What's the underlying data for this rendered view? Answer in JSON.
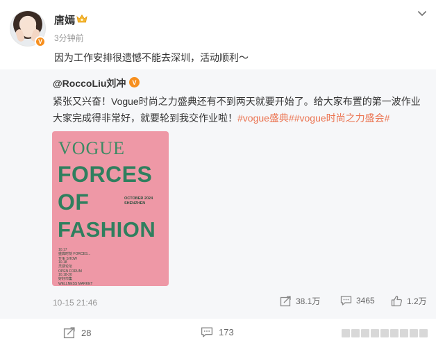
{
  "post": {
    "author": "唐嫣",
    "time": "3分钟前",
    "text": "因为工作安排很遗憾不能去深圳，活动顺利～"
  },
  "repost": {
    "author": "@RoccoLiu刘冲",
    "line1": "紧张又兴奋！Vogue时尚之力盛典还有不到两天就要开始了。给大家布置的第一波作业",
    "line2_plain": "大家完成得非常好，就要轮到我交作业啦！",
    "hashtags": "#vogue盛典##vogue时尚之力盛会#",
    "poster": {
      "brand": "VOGUE",
      "line1": "FORCES",
      "line2": "OF",
      "line3": "FASHION",
      "date_line1": "OCTOBER 2024",
      "date_line2": "SHENZHEN",
      "small1": "10.17\n盛典时刻 FORCES...\nTHE SHOW",
      "small2": "10.18\n灵感论坛\nOPEN FORUM",
      "small3": "10.18-20\n好好市集\nWELLNESS MARKET"
    },
    "time": "10-15 21:46",
    "shares": "38.1万",
    "comments": "3465",
    "likes": "1.2万"
  },
  "actions": {
    "forward_count": "28",
    "comment_count": "173"
  },
  "colors": {
    "hashtag": "#eb7350",
    "verified_badge": "#f78f1e",
    "poster_bg": "#ee98a6",
    "poster_text": "#2f7f5e"
  }
}
